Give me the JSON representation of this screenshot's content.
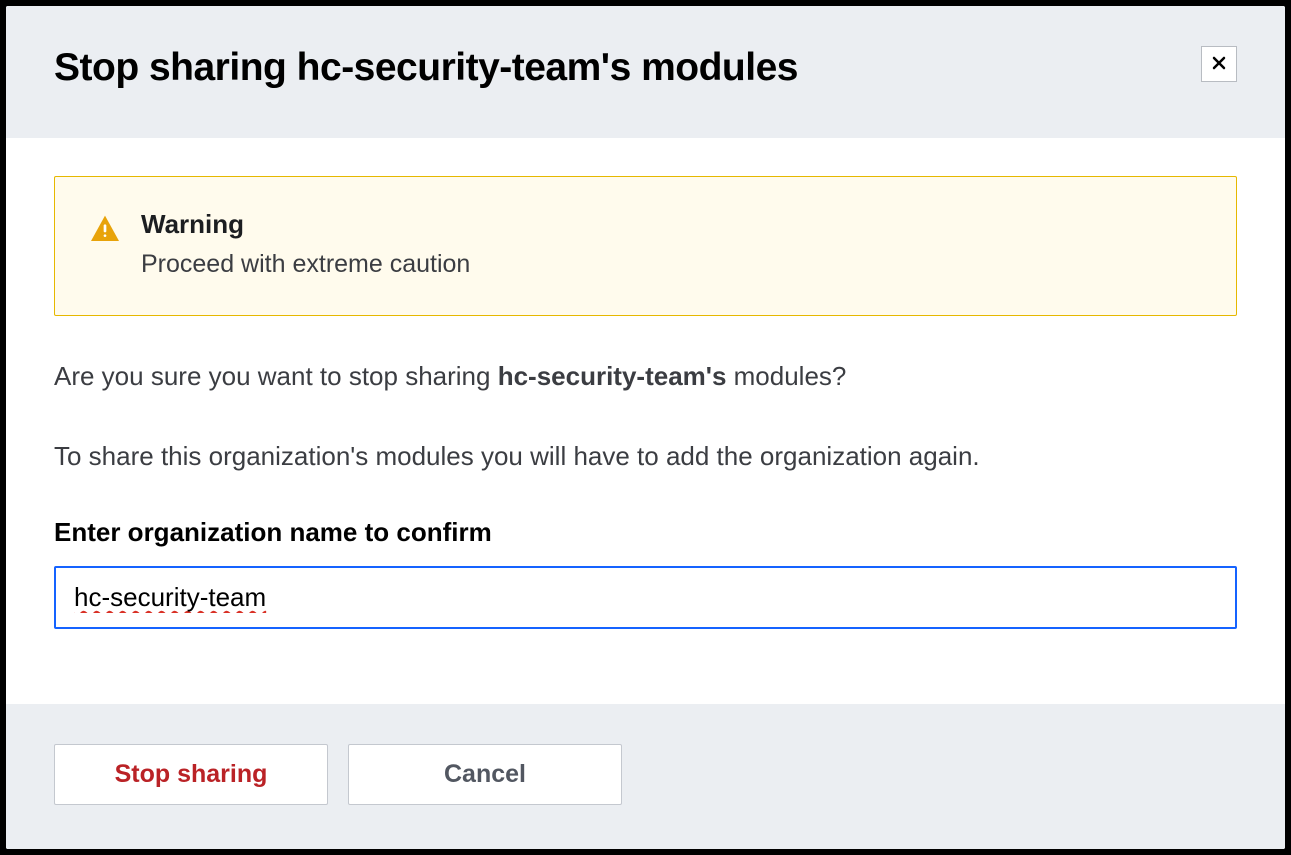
{
  "modal": {
    "title": "Stop sharing hc-security-team's modules",
    "warning": {
      "title": "Warning",
      "subtitle": "Proceed with extreme caution"
    },
    "question_prefix": "Are you sure you want to stop sharing ",
    "question_org": "hc-security-team's",
    "question_suffix": " modules?",
    "info_line": "To share this organization's modules you will have to add the organization again.",
    "input_label": "Enter organization name to confirm",
    "input_value": "hc-security-team",
    "buttons": {
      "stop": "Stop sharing",
      "cancel": "Cancel"
    }
  },
  "colors": {
    "warning_border": "#e6b800",
    "warning_bg": "#fffbed",
    "focus_border": "#1563ff",
    "danger_text": "#ba2226",
    "header_bg": "#ebeef2"
  }
}
